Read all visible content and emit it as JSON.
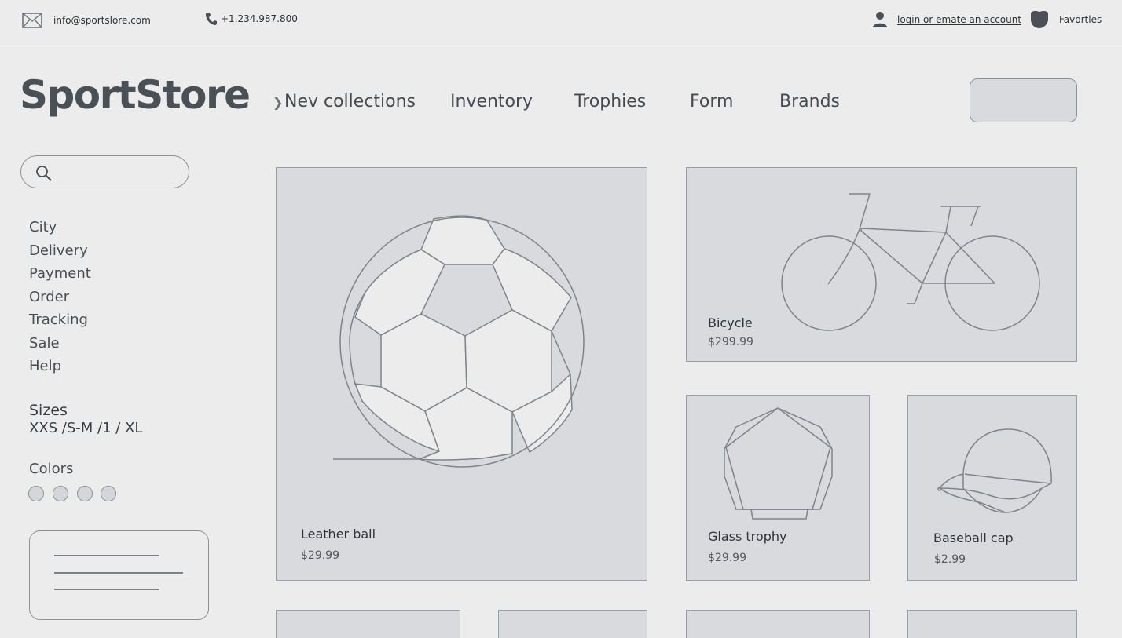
{
  "topbar": {
    "email": "info@sportslore.com",
    "phone": "+1.234.987.800",
    "login": "login or emate an account",
    "favorites": "Favortles",
    "icons": [
      "mail-icon",
      "phone-icon",
      "user-icon",
      "heart-icon"
    ]
  },
  "header": {
    "logo": "SportStore",
    "nav": [
      "Nev collections",
      "Inventory",
      "Trophies",
      "Form",
      "Brands"
    ]
  },
  "sidebar": {
    "search_placeholder": "",
    "items": [
      "City",
      "Delivery",
      "Payment",
      "Order",
      "Tracking",
      "Sale",
      "Help"
    ],
    "sizes_title": "Sizes",
    "sizes_value": "XXS /S-M /1 / XL",
    "colors_title": "Colors",
    "color_swatch_count": 4
  },
  "products": [
    {
      "name": "Leather ball",
      "price": "$29.99",
      "icon": "soccer-ball-icon"
    },
    {
      "name": "Bicycle",
      "price": "$299.99",
      "icon": "bicycle-icon"
    },
    {
      "name": "Glass trophy",
      "price": "$29.99",
      "icon": "trophy-icon"
    },
    {
      "name": "Baseball cap",
      "price": "$2.99",
      "icon": "cap-icon"
    }
  ],
  "colors": {
    "background": "#ececec",
    "card": "#d9dadd",
    "border": "#9a9ea3",
    "text": "#3d4348"
  }
}
